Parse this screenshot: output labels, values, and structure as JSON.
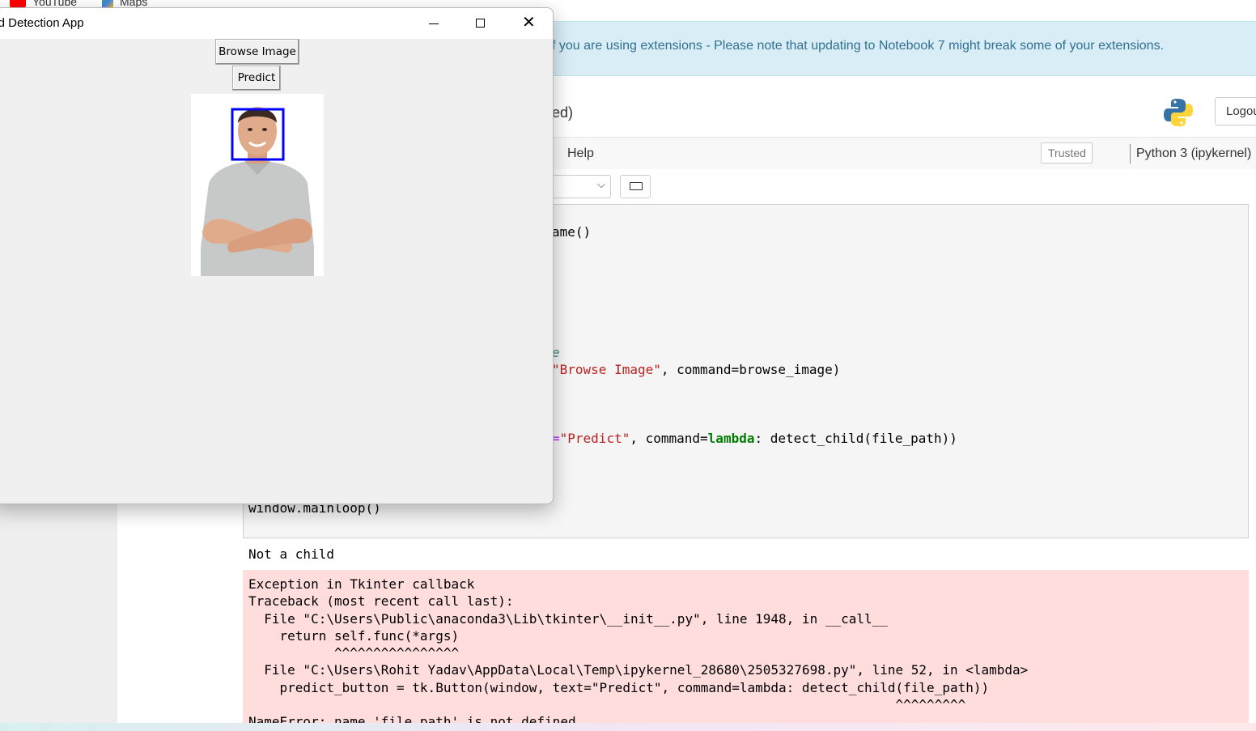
{
  "browser_bookmarks": [
    {
      "label": "YouTube",
      "icon": "youtube-icon"
    },
    {
      "label": "Maps",
      "icon": "maps-icon"
    }
  ],
  "notebook": {
    "banner_text": "f you are using extensions - Please note that updating to Notebook 7 might break some of your extensions.",
    "title_fragment": "ed)",
    "logout_label": "Logou",
    "menu_help": "Help",
    "trusted_label": "Trusted",
    "kernel_name": "Python 3 (ipykernel)",
    "code_lines": {
      "line1": "ame()",
      "line2_comment": "e",
      "line3_prefix": "\"Browse Image\"",
      "line3_suffix": ", command=browse_image)",
      "line4_eq": "=",
      "line4_str": "\"Predict\"",
      "line4_mid": ", command=",
      "line4_kw": "lambda",
      "line4_end": ": detect_child(file_path))",
      "line5": "window.mainloop()"
    },
    "output_text": "Not a child",
    "stderr_lines": [
      "Exception in Tkinter callback",
      "Traceback (most recent call last):",
      "  File \"C:\\Users\\Public\\anaconda3\\Lib\\tkinter\\__init__.py\", line 1948, in __call__",
      "    return self.func(*args)",
      "           ^^^^^^^^^^^^^^^^",
      "  File \"C:\\Users\\Rohit Yadav\\AppData\\Local\\Temp\\ipykernel_28680\\2505327698.py\", line 52, in <lambda>",
      "    predict_button = tk.Button(window, text=\"Predict\", command=lambda: detect_child(file_path))",
      "                                                                                   ^^^^^^^^^",
      "NameError: name 'file_path' is not defined"
    ]
  },
  "tk_window": {
    "title": "ild Detection App",
    "browse_label": "Browse Image",
    "predict_label": "Predict",
    "photo_description": "",
    "colors": {
      "detection_box": "#0000ff"
    }
  }
}
